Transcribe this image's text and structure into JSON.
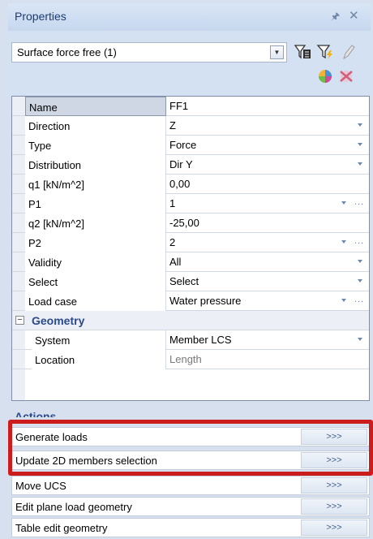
{
  "titlebar": {
    "title": "Properties",
    "pin_icon": "pin-icon",
    "close_icon": "close-icon"
  },
  "selector": {
    "value": "Surface force free (1)"
  },
  "properties": [
    {
      "name": "Name",
      "value": "FF1",
      "dropdown": false,
      "dots": false,
      "selected": true
    },
    {
      "name": "Direction",
      "value": "Z",
      "dropdown": true,
      "dots": false
    },
    {
      "name": "Type",
      "value": "Force",
      "dropdown": true,
      "dots": false
    },
    {
      "name": "Distribution",
      "value": "Dir Y",
      "dropdown": true,
      "dots": false
    },
    {
      "name": "q1 [kN/m^2]",
      "value": "0,00",
      "dropdown": false,
      "dots": false
    },
    {
      "name": "P1",
      "value": "1",
      "dropdown": true,
      "dots": true
    },
    {
      "name": "q2 [kN/m^2]",
      "value": "-25,00",
      "dropdown": false,
      "dots": false
    },
    {
      "name": "P2",
      "value": "2",
      "dropdown": true,
      "dots": true
    },
    {
      "name": "Validity",
      "value": "All",
      "dropdown": true,
      "dots": false
    },
    {
      "name": "Select",
      "value": "Select",
      "dropdown": true,
      "dots": false
    },
    {
      "name": "Load case",
      "value": "Water pressure",
      "dropdown": true,
      "dots": true
    }
  ],
  "geometry": {
    "label": "Geometry",
    "toggle": "−",
    "items": [
      {
        "name": "System",
        "value": "Member LCS",
        "dropdown": true
      },
      {
        "name": "Location",
        "value": "Length",
        "greyed": true
      }
    ]
  },
  "actions": {
    "label": "Actions",
    "button_label": ">>>",
    "items": [
      {
        "label": "Generate loads"
      },
      {
        "label": "Update 2D members selection"
      },
      {
        "label": "Move UCS"
      },
      {
        "label": "Edit plane load geometry"
      },
      {
        "label": "Table edit geometry"
      }
    ]
  },
  "colors": {
    "highlight": "#cc1d1d",
    "accent": "#2b4a8b"
  }
}
